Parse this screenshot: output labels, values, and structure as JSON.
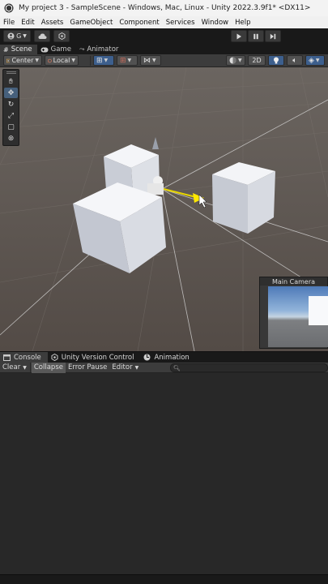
{
  "window": {
    "title": "My project 3 - SampleScene - Windows, Mac, Linux - Unity 2022.3.9f1* <DX11>"
  },
  "menu": [
    "File",
    "Edit",
    "Assets",
    "GameObject",
    "Component",
    "Services",
    "Window",
    "Help"
  ],
  "main_toolbar": {
    "account_label": "G",
    "play_icons": [
      "play-icon",
      "pause-icon",
      "step-icon"
    ]
  },
  "scene_tabs": [
    {
      "label": "Scene",
      "icon": "grid-icon",
      "active": true
    },
    {
      "label": "Game",
      "icon": "gamepad-icon",
      "active": false
    },
    {
      "label": "Animator",
      "icon": "animator-icon",
      "active": false
    }
  ],
  "scene_toolbar": {
    "pivot_label": "Center",
    "space_label": "Local",
    "mode_2d_label": "2D"
  },
  "tools": [
    "hand-tool-icon",
    "move-tool-icon",
    "rotate-tool-icon",
    "scale-tool-icon",
    "rect-tool-icon",
    "transform-tool-icon"
  ],
  "camera_preview": {
    "title": "Main Camera"
  },
  "console_tabs": [
    {
      "label": "Console",
      "icon": "console-icon",
      "active": true
    },
    {
      "label": "Unity Version Control",
      "icon": "version-control-icon",
      "active": false
    },
    {
      "label": "Animation",
      "icon": "animation-icon",
      "active": false
    }
  ],
  "console_toolbar": {
    "clear_label": "Clear",
    "collapse_label": "Collapse",
    "error_pause_label": "Error Pause",
    "editor_label": "Editor",
    "search_placeholder": ""
  },
  "colors": {
    "accent": "#3d5f8d",
    "scene_background": "#59524d",
    "sky_top": "#6d6662"
  }
}
